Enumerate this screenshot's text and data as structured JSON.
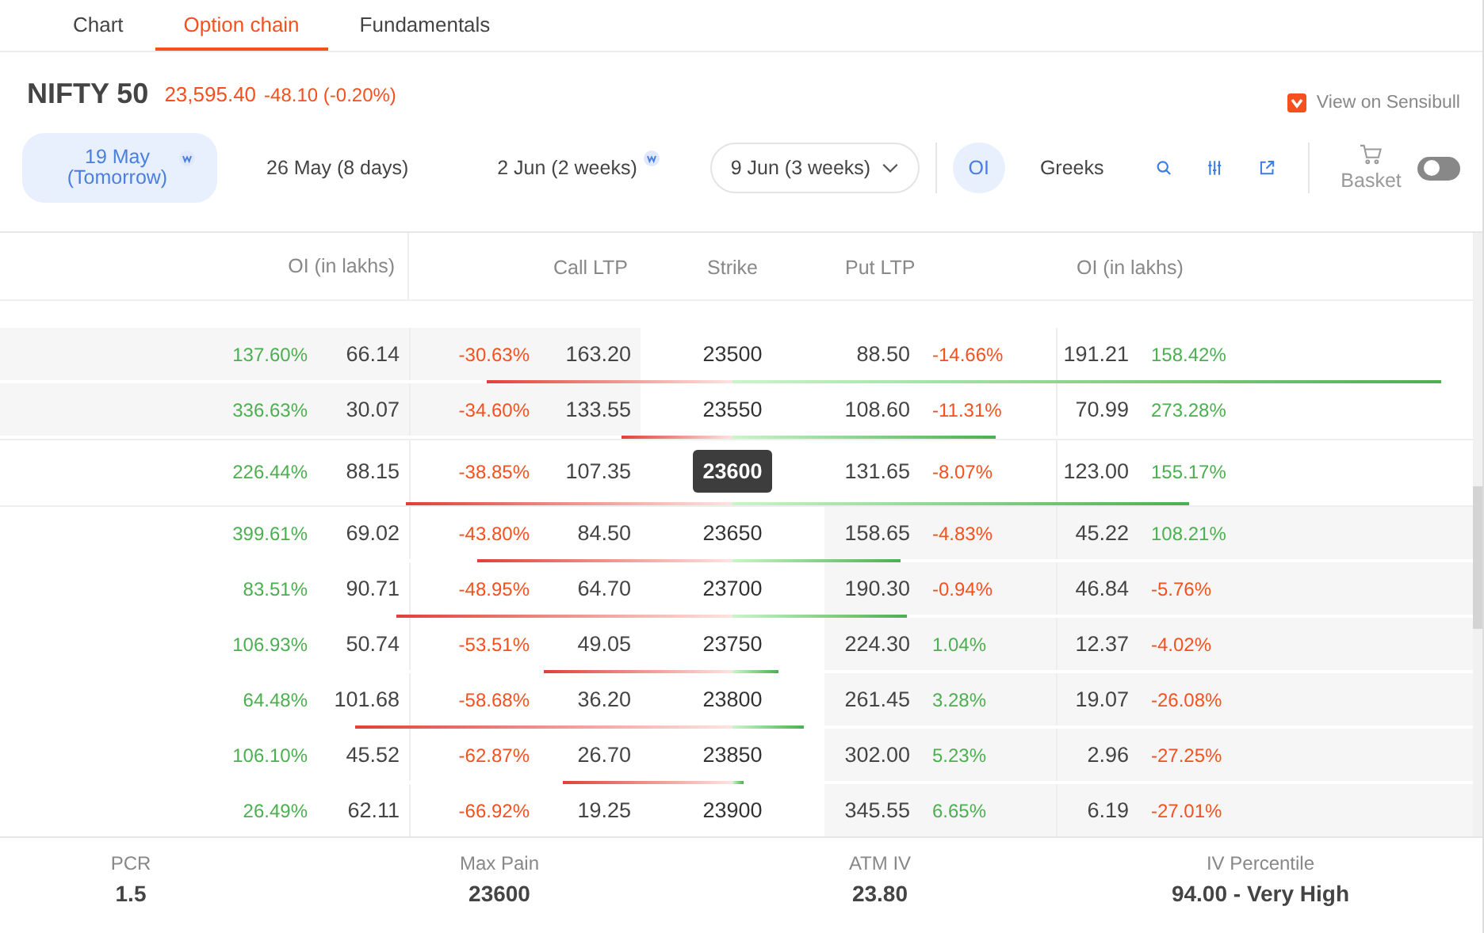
{
  "tabs": [
    {
      "label": "Chart",
      "selected": false
    },
    {
      "label": "Option chain",
      "selected": true
    },
    {
      "label": "Fundamentals",
      "selected": false
    }
  ],
  "instrument": {
    "name": "NIFTY 50",
    "price": "23,595.40",
    "change": "-48.10 (-0.20%)",
    "link": "View on Sensibull"
  },
  "expiries": [
    {
      "kind": "pill",
      "label": "19 May (Tomorrow)",
      "weekly": true,
      "selected": true
    },
    {
      "kind": "pill",
      "label": "26 May (8 days)",
      "weekly": false,
      "selected": false
    },
    {
      "kind": "pill",
      "label": "2 Jun (2 weeks)",
      "weekly": true,
      "selected": false
    },
    {
      "kind": "dropdown",
      "label": "9 Jun (3 weeks)",
      "weekly": false,
      "selected": false
    }
  ],
  "views": [
    {
      "label": "OI",
      "selected": true
    },
    {
      "label": "Greeks",
      "selected": false
    }
  ],
  "basket": {
    "label": "Basket",
    "on": false
  },
  "columns": {
    "call_oi": "OI (in lakhs)",
    "call_ltp": "Call LTP",
    "strike": "Strike",
    "put_ltp": "Put LTP",
    "put_oi": "OI (in lakhs)"
  },
  "rows": [
    {
      "call_oi_chg": {
        "text": "137.60%",
        "up": true
      },
      "call_oi": "66.14",
      "call_chg": {
        "text": "-30.63%",
        "up": false
      },
      "call_ltp": "163.20",
      "strike": "23500",
      "put_ltp": "88.50",
      "put_chg": {
        "text": "-14.66%",
        "up": false
      },
      "put_oi": "191.21",
      "put_oi_chg": {
        "text": "158.42%",
        "up": true
      },
      "call_itm": true,
      "put_itm": false,
      "atm": false
    },
    {
      "call_oi_chg": {
        "text": "336.63%",
        "up": true
      },
      "call_oi": "30.07",
      "call_chg": {
        "text": "-34.60%",
        "up": false
      },
      "call_ltp": "133.55",
      "strike": "23550",
      "put_ltp": "108.60",
      "put_chg": {
        "text": "-11.31%",
        "up": false
      },
      "put_oi": "70.99",
      "put_oi_chg": {
        "text": "273.28%",
        "up": true
      },
      "call_itm": true,
      "put_itm": false,
      "atm": false
    },
    {
      "call_oi_chg": {
        "text": "226.44%",
        "up": true
      },
      "call_oi": "88.15",
      "call_chg": {
        "text": "-38.85%",
        "up": false
      },
      "call_ltp": "107.35",
      "strike": "23600",
      "put_ltp": "131.65",
      "put_chg": {
        "text": "-8.07%",
        "up": false
      },
      "put_oi": "123.00",
      "put_oi_chg": {
        "text": "155.17%",
        "up": true
      },
      "call_itm": false,
      "put_itm": false,
      "atm": true
    },
    {
      "call_oi_chg": {
        "text": "399.61%",
        "up": true
      },
      "call_oi": "69.02",
      "call_chg": {
        "text": "-43.80%",
        "up": false
      },
      "call_ltp": "84.50",
      "strike": "23650",
      "put_ltp": "158.65",
      "put_chg": {
        "text": "-4.83%",
        "up": false
      },
      "put_oi": "45.22",
      "put_oi_chg": {
        "text": "108.21%",
        "up": true
      },
      "call_itm": false,
      "put_itm": true,
      "atm": false
    },
    {
      "call_oi_chg": {
        "text": "83.51%",
        "up": true
      },
      "call_oi": "90.71",
      "call_chg": {
        "text": "-48.95%",
        "up": false
      },
      "call_ltp": "64.70",
      "strike": "23700",
      "put_ltp": "190.30",
      "put_chg": {
        "text": "-0.94%",
        "up": false
      },
      "put_oi": "46.84",
      "put_oi_chg": {
        "text": "-5.76%",
        "up": false
      },
      "call_itm": false,
      "put_itm": true,
      "atm": false
    },
    {
      "call_oi_chg": {
        "text": "106.93%",
        "up": true
      },
      "call_oi": "50.74",
      "call_chg": {
        "text": "-53.51%",
        "up": false
      },
      "call_ltp": "49.05",
      "strike": "23750",
      "put_ltp": "224.30",
      "put_chg": {
        "text": "1.04%",
        "up": true
      },
      "put_oi": "12.37",
      "put_oi_chg": {
        "text": "-4.02%",
        "up": false
      },
      "call_itm": false,
      "put_itm": true,
      "atm": false
    },
    {
      "call_oi_chg": {
        "text": "64.48%",
        "up": true
      },
      "call_oi": "101.68",
      "call_chg": {
        "text": "-58.68%",
        "up": false
      },
      "call_ltp": "36.20",
      "strike": "23800",
      "put_ltp": "261.45",
      "put_chg": {
        "text": "3.28%",
        "up": true
      },
      "put_oi": "19.07",
      "put_oi_chg": {
        "text": "-26.08%",
        "up": false
      },
      "call_itm": false,
      "put_itm": true,
      "atm": false
    },
    {
      "call_oi_chg": {
        "text": "106.10%",
        "up": true
      },
      "call_oi": "45.52",
      "call_chg": {
        "text": "-62.87%",
        "up": false
      },
      "call_ltp": "26.70",
      "strike": "23850",
      "put_ltp": "302.00",
      "put_chg": {
        "text": "5.23%",
        "up": true
      },
      "put_oi": "2.96",
      "put_oi_chg": {
        "text": "-27.25%",
        "up": false
      },
      "call_itm": false,
      "put_itm": true,
      "atm": false
    },
    {
      "call_oi_chg": {
        "text": "26.49%",
        "up": true
      },
      "call_oi": "62.11",
      "call_chg": {
        "text": "-66.92%",
        "up": false
      },
      "call_ltp": "19.25",
      "strike": "23900",
      "put_ltp": "345.55",
      "put_chg": {
        "text": "6.65%",
        "up": true
      },
      "put_oi": "6.19",
      "put_oi_chg": {
        "text": "-27.01%",
        "up": false
      },
      "call_itm": false,
      "put_itm": true,
      "atm": false
    }
  ],
  "stats": [
    {
      "label": "PCR",
      "value": "1.5"
    },
    {
      "label": "Max Pain",
      "value": "23600"
    },
    {
      "label": "ATM IV",
      "value": "23.80"
    },
    {
      "label": "IV Percentile",
      "value": "94.00 - Very High"
    }
  ]
}
